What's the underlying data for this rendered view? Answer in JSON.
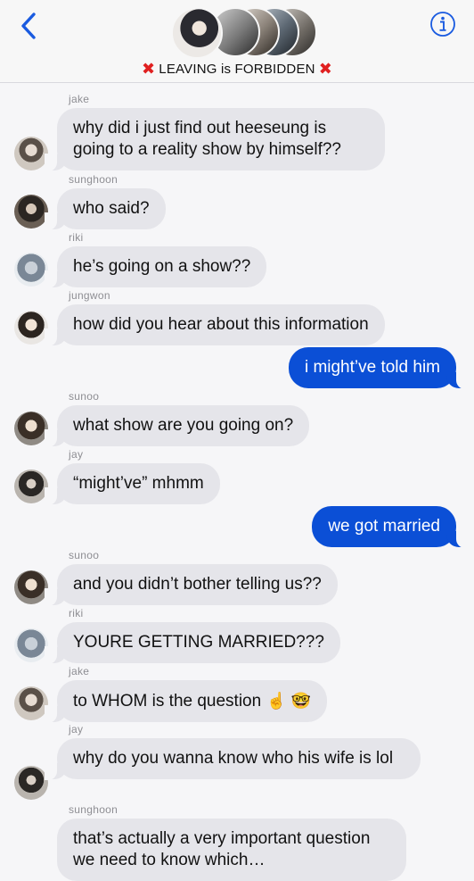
{
  "header": {
    "group_title": "LEAVING is FORBIDDEN",
    "icons": {
      "back": "chevron-left-icon",
      "info": "info-icon",
      "title_marks": "red-x-icon"
    }
  },
  "messages": [
    {
      "sender": "jake",
      "text": "why did i just find out heeseung is going to a reality show by himself??",
      "direction": "in"
    },
    {
      "sender": "sunghoon",
      "text": "who said?",
      "direction": "in"
    },
    {
      "sender": "riki",
      "text": "he’s going on a show??",
      "direction": "in"
    },
    {
      "sender": "jungwon",
      "text": "how did you hear about this information",
      "direction": "in"
    },
    {
      "sender": "",
      "text": "i might’ve told him",
      "direction": "out"
    },
    {
      "sender": "sunoo",
      "text": "what show are you going on?",
      "direction": "in"
    },
    {
      "sender": "jay",
      "text": "“might’ve” mhmm",
      "direction": "in"
    },
    {
      "sender": "",
      "text": "we got married",
      "direction": "out"
    },
    {
      "sender": "sunoo",
      "text": "and you didn’t bother telling us??",
      "direction": "in"
    },
    {
      "sender": "riki",
      "text": "YOURE GETTING MARRIED???",
      "direction": "in"
    },
    {
      "sender": "jake",
      "text": "to WHOM is the question",
      "emoji": "☝️ 🤓",
      "direction": "in"
    },
    {
      "sender": "jay",
      "text": "why do you wanna know who his wife is lol",
      "direction": "in"
    },
    {
      "sender": "sunghoon",
      "text": "that’s actually a very important question we need to know which… ",
      "direction": "in"
    }
  ]
}
